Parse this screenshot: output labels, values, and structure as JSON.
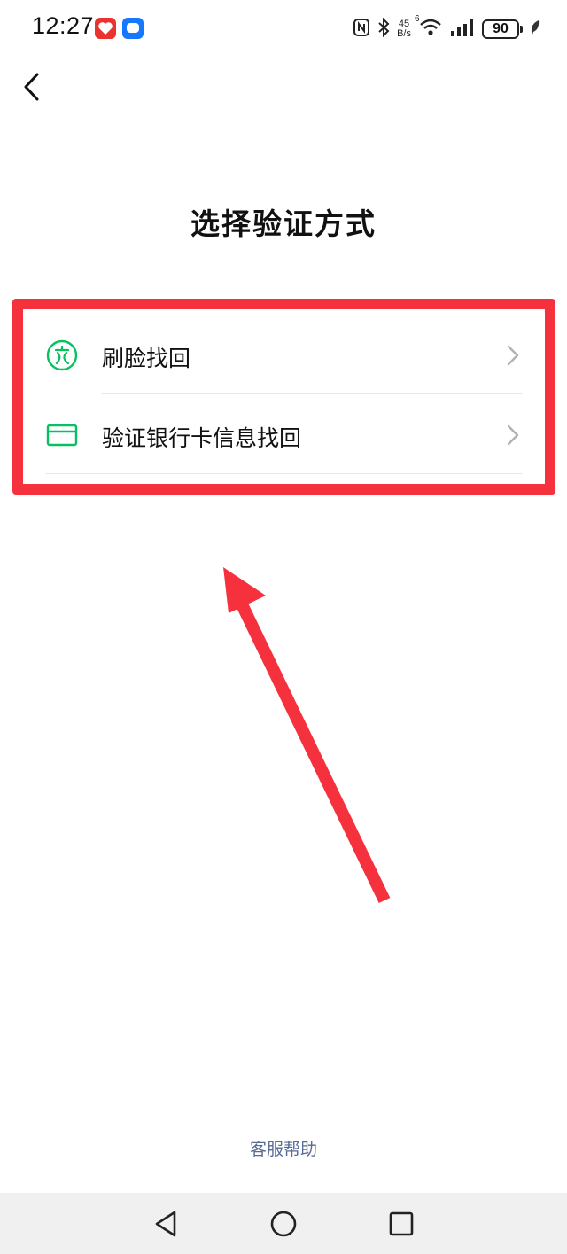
{
  "status_bar": {
    "time": "12:27",
    "apps": [
      "red-app-icon",
      "blue-app-icon"
    ],
    "net_speed_value": "45",
    "net_speed_unit": "B/s",
    "network_label": "6",
    "battery": "90",
    "icons": [
      "nfc-icon",
      "bluetooth-icon",
      "wifi-icon",
      "signal-icon",
      "battery-icon",
      "leaf-icon"
    ]
  },
  "header": {
    "title": "选择验证方式"
  },
  "options": [
    {
      "label": "刷脸找回",
      "icon": "face-recognition-icon"
    },
    {
      "label": "验证银行卡信息找回",
      "icon": "bank-card-icon"
    }
  ],
  "footer": {
    "help_link": "客服帮助"
  },
  "nav_bar": {
    "buttons": [
      "back",
      "home",
      "recents"
    ]
  },
  "colors": {
    "accent_green": "#07c160",
    "annotation_red": "#f5313d",
    "link_blue": "#576b95"
  }
}
